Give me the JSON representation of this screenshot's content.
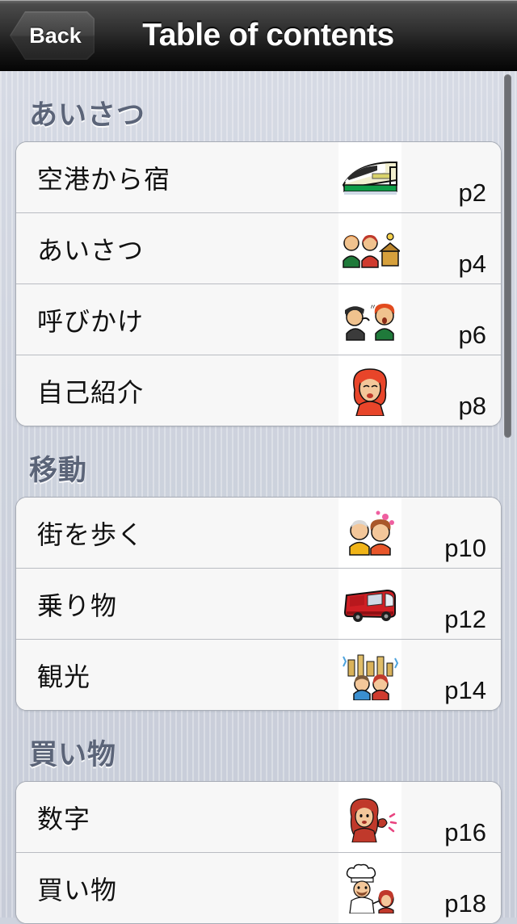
{
  "navbar": {
    "back_label": "Back",
    "title": "Table of contents"
  },
  "sections": [
    {
      "title": "あいさつ",
      "rows": [
        {
          "label": "空港から宿",
          "page": "p2",
          "thumb": "bullet-train-icon"
        },
        {
          "label": "あいさつ",
          "page": "p4",
          "thumb": "two-people-greeting-icon"
        },
        {
          "label": "呼びかけ",
          "page": "p6",
          "thumb": "calling-out-icon"
        },
        {
          "label": "自己紹介",
          "page": "p8",
          "thumb": "woman-portrait-icon"
        }
      ]
    },
    {
      "title": "移動",
      "rows": [
        {
          "label": "街を歩く",
          "page": "p10",
          "thumb": "couple-walking-icon"
        },
        {
          "label": "乗り物",
          "page": "p12",
          "thumb": "red-bus-icon"
        },
        {
          "label": "観光",
          "page": "p14",
          "thumb": "sightseeing-icon"
        }
      ]
    },
    {
      "title": "買い物",
      "rows": [
        {
          "label": "数字",
          "page": "p16",
          "thumb": "woman-counting-icon"
        },
        {
          "label": "買い物",
          "page": "p18",
          "thumb": "chef-shopping-icon"
        }
      ]
    }
  ],
  "colors": {
    "navbar_dark": "#161616",
    "background": "#ced3de",
    "section_title": "#5b6478",
    "cell_background": "#f7f7f7",
    "scrollbar": "#6d6f74"
  }
}
